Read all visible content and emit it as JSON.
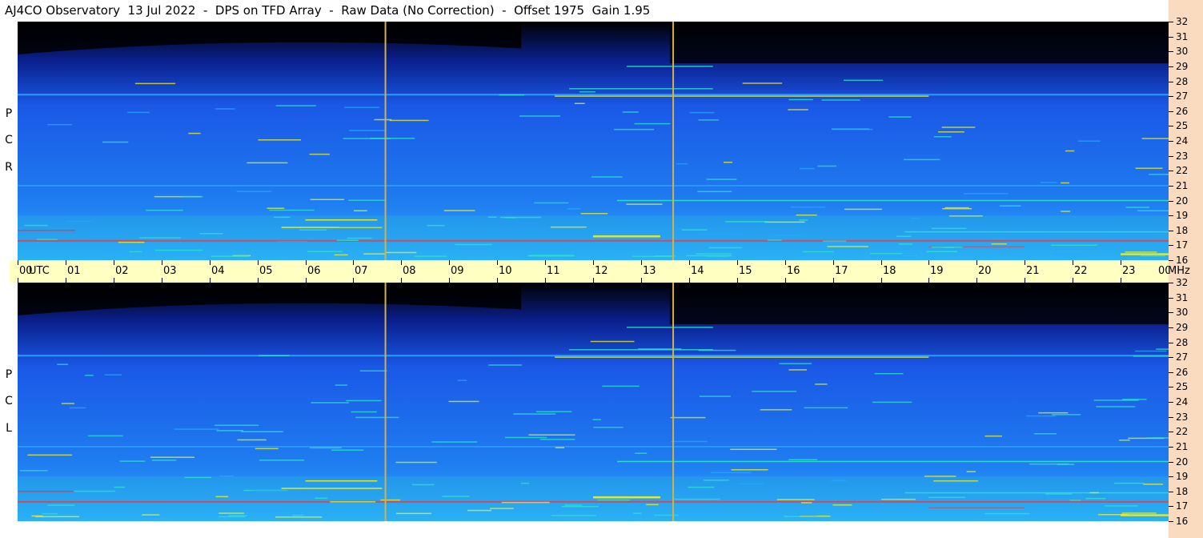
{
  "title": "AJ4CO Observatory  13 Jul 2022  -  DPS on TFD Array  -  Raw Data (No Correction)  -  Offset 1975  Gain 1.95",
  "chart_data": {
    "type": "heatmap",
    "panels": [
      {
        "name": "RCP",
        "label_letters": [
          "P",
          "C",
          "R"
        ]
      },
      {
        "name": "LCP",
        "label_letters": [
          "P",
          "C",
          "L"
        ]
      }
    ],
    "x_axis": {
      "unit_label": "UTC",
      "range_hours": [
        0,
        24
      ],
      "tick_labels": [
        "00",
        "01",
        "02",
        "03",
        "04",
        "05",
        "06",
        "07",
        "08",
        "09",
        "10",
        "11",
        "12",
        "13",
        "14",
        "15",
        "16",
        "17",
        "18",
        "19",
        "20",
        "21",
        "22",
        "23",
        "00"
      ]
    },
    "y_axis": {
      "unit_label": "MHz",
      "range_mhz": [
        16,
        32
      ],
      "tick_labels": [
        "32",
        "31",
        "30",
        "29",
        "28",
        "27",
        "26",
        "25",
        "24",
        "23",
        "22",
        "21",
        "20",
        "19",
        "18",
        "17",
        "16"
      ]
    },
    "vertical_markers_utc": [
      7.67,
      13.67
    ],
    "colors": {
      "night_top": "#000000",
      "high_band": "#0a1f8c",
      "mid_band": "#1a58e6",
      "low_band": "#2aa6ff",
      "noise": "#2ee6c8",
      "interference": "#f0f020",
      "strong_signal": "#ff3030",
      "marker_line": "#d8b040"
    }
  }
}
